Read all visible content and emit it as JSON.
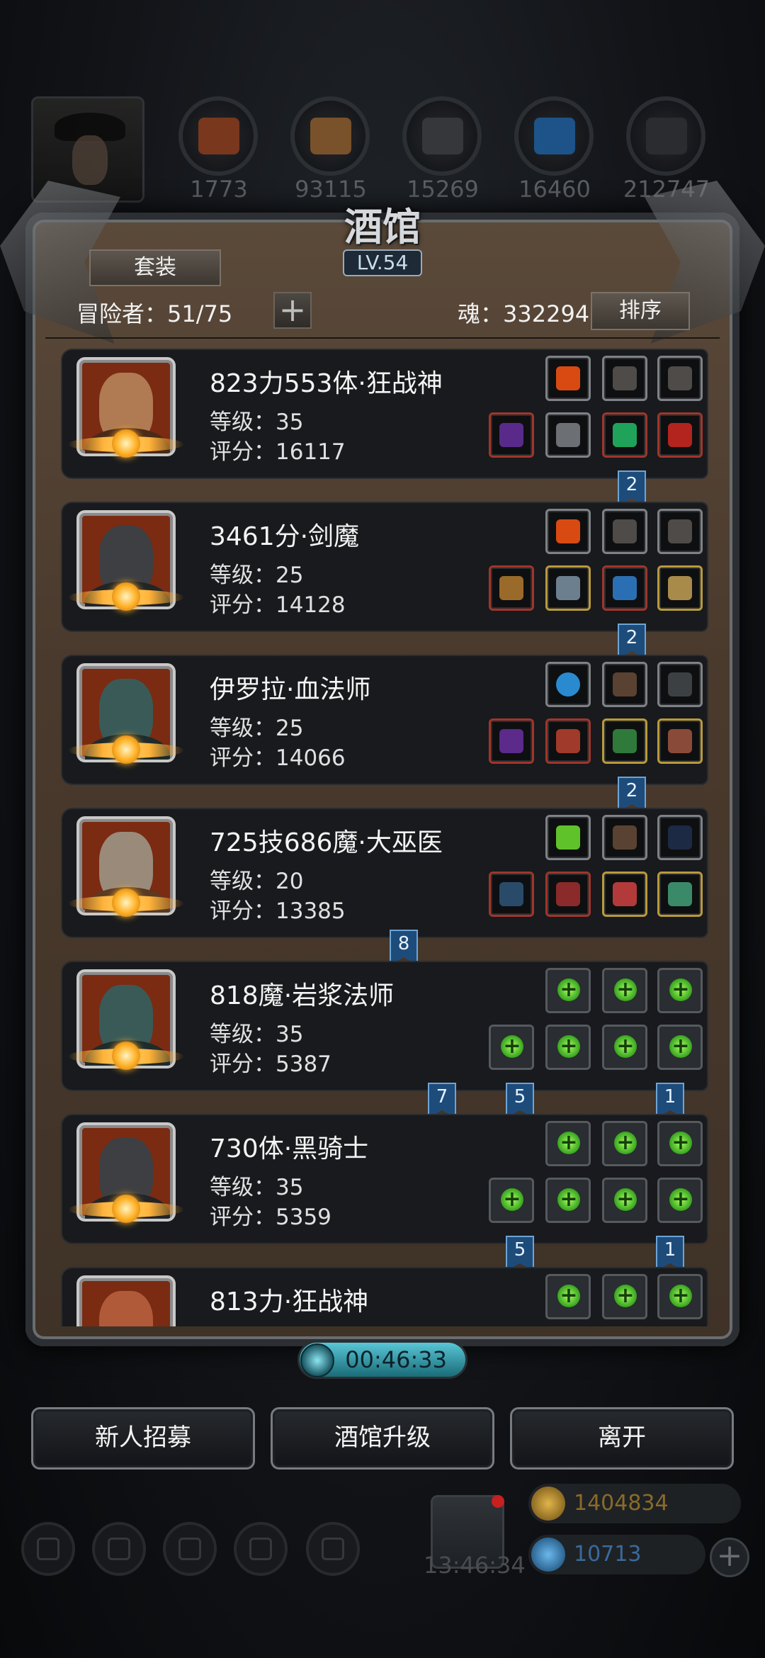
{
  "top_bar": {
    "resources": [
      {
        "icon": "meat-icon",
        "value": "1773"
      },
      {
        "icon": "wood-icon",
        "value": "93115"
      },
      {
        "icon": "iron-icon",
        "value": "15269"
      },
      {
        "icon": "crystal-icon",
        "value": "16460"
      },
      {
        "icon": "stone-icon",
        "value": "212747"
      }
    ]
  },
  "panel": {
    "title": "酒馆",
    "level": "LV.54",
    "tab_label": "套装",
    "adventurers": "冒险者：51/75",
    "soul": "魂：332294",
    "sort_label": "排序"
  },
  "heroes": [
    {
      "name": "823力553体·狂战神",
      "level": "等级：35",
      "score": "评分：16117",
      "link": "2"
    },
    {
      "name": "3461分·剑魔",
      "level": "等级：25",
      "score": "评分：14128",
      "link": "2"
    },
    {
      "name": "伊罗拉·血法师",
      "level": "等级：25",
      "score": "评分：14066",
      "link": "2"
    },
    {
      "name": "725技686魔·大巫医",
      "level": "等级：20",
      "score": "评分：13385",
      "link": "8"
    },
    {
      "name": "818魔·岩浆法师",
      "level": "等级：35",
      "score": "评分：5387",
      "links": [
        "7",
        "5",
        "1"
      ]
    },
    {
      "name": "730体·黑骑士",
      "level": "等级：35",
      "score": "评分：5359",
      "links": [
        "5",
        "1"
      ]
    },
    {
      "name": "813力·狂战神",
      "level": "",
      "score": ""
    }
  ],
  "timer": "00:46:33",
  "actions": {
    "recruit": "新人招募",
    "upgrade": "酒馆升级",
    "leave": "离开"
  },
  "footer": {
    "clock": "13:46:34",
    "gold": "1404834",
    "gems": "10713"
  },
  "colors": {
    "panel": "#4a3a2d",
    "card": "#181a1d",
    "ribbon": "#1e4c7a",
    "timer": "#59c6d6"
  }
}
